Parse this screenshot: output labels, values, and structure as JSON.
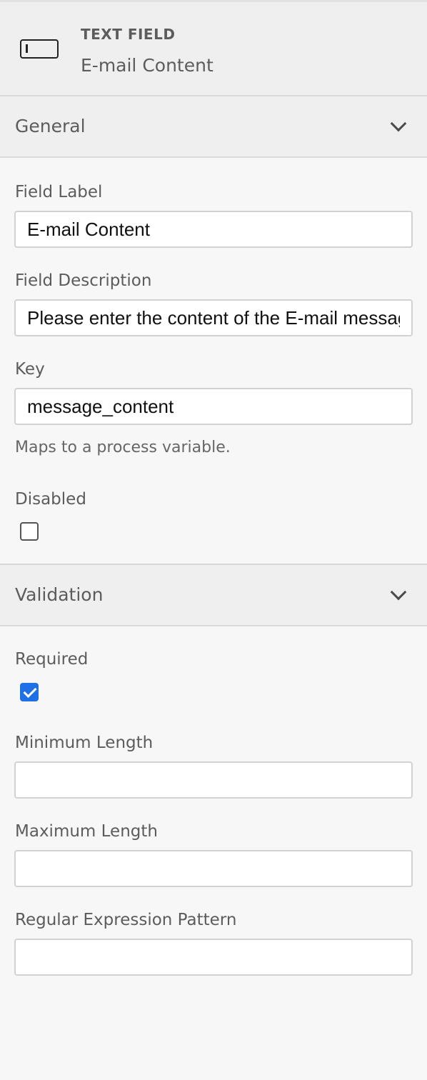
{
  "header": {
    "type_label": "TEXT FIELD",
    "element_name": "E-mail Content",
    "icon": "textfield-icon"
  },
  "groups": {
    "general": {
      "title": "General",
      "icon": "chevron-down-icon",
      "field_label": {
        "label": "Field Label",
        "value": "E-mail Content"
      },
      "field_description": {
        "label": "Field Description",
        "value": "Please enter the content of the E-mail message"
      },
      "key": {
        "label": "Key",
        "value": "message_content",
        "description": "Maps to a process variable."
      },
      "disabled": {
        "label": "Disabled",
        "checked": false
      }
    },
    "validation": {
      "title": "Validation",
      "icon": "chevron-down-icon",
      "required": {
        "label": "Required",
        "checked": true
      },
      "min_length": {
        "label": "Minimum Length",
        "value": ""
      },
      "max_length": {
        "label": "Maximum Length",
        "value": ""
      },
      "pattern": {
        "label": "Regular Expression Pattern",
        "value": ""
      }
    }
  },
  "colors": {
    "checkbox_checked": "#1f6fe6",
    "header_bg": "#efefef",
    "panel_bg": "#f7f7f7"
  }
}
